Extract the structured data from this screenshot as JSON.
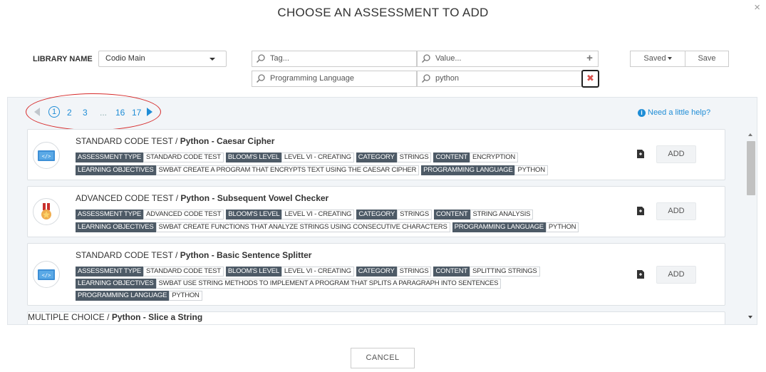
{
  "dialog": {
    "title": "CHOOSE AN ASSESSMENT TO ADD",
    "close_glyph": "×"
  },
  "library": {
    "label": "LIBRARY NAME",
    "selected": "Codio Main"
  },
  "filters": {
    "tag_placeholder": "Tag...",
    "value_placeholder": "Value...",
    "add_glyph": "+",
    "active": [
      {
        "tag": "Programming Language",
        "value": "python",
        "remove_glyph": "✖"
      }
    ]
  },
  "saved": {
    "saved_label": "Saved",
    "save_label": "Save"
  },
  "pagination": {
    "current": "1",
    "pages": [
      "2",
      "3",
      "...",
      "16",
      "17"
    ]
  },
  "help": {
    "label": "Need a little help?",
    "icon": "info-icon"
  },
  "assessments": [
    {
      "type_label": "STANDARD CODE TEST",
      "name": "Python - Caesar Cipher",
      "icon": "code-icon",
      "add_label": "ADD",
      "tags": [
        [
          [
            "ASSESSMENT TYPE",
            "STANDARD CODE TEST"
          ],
          [
            "BLOOM'S LEVEL",
            "LEVEL VI - CREATING"
          ],
          [
            "CATEGORY",
            "STRINGS"
          ],
          [
            "CONTENT",
            "ENCRYPTION"
          ]
        ],
        [
          [
            "LEARNING OBJECTIVES",
            "SWBAT CREATE A PROGRAM THAT ENCRYPTS TEXT USING THE CAESAR CIPHER"
          ],
          [
            "PROGRAMMING LANGUAGE",
            "PYTHON"
          ]
        ]
      ]
    },
    {
      "type_label": "ADVANCED CODE TEST",
      "name": "Python - Subsequent Vowel Checker",
      "icon": "medal-icon",
      "add_label": "ADD",
      "tags": [
        [
          [
            "ASSESSMENT TYPE",
            "ADVANCED CODE TEST"
          ],
          [
            "BLOOM'S LEVEL",
            "LEVEL VI - CREATING"
          ],
          [
            "CATEGORY",
            "STRINGS"
          ],
          [
            "CONTENT",
            "STRING ANALYSIS"
          ]
        ],
        [
          [
            "LEARNING OBJECTIVES",
            "SWBAT CREATE FUNCTIONS THAT ANALYZE STRINGS USING CONSECUTIVE CHARACTERS"
          ],
          [
            "PROGRAMMING LANGUAGE",
            "PYTHON"
          ]
        ]
      ]
    },
    {
      "type_label": "STANDARD CODE TEST",
      "name": "Python - Basic Sentence Splitter",
      "icon": "code-icon",
      "add_label": "ADD",
      "tags": [
        [
          [
            "ASSESSMENT TYPE",
            "STANDARD CODE TEST"
          ],
          [
            "BLOOM'S LEVEL",
            "LEVEL VI - CREATING"
          ],
          [
            "CATEGORY",
            "STRINGS"
          ],
          [
            "CONTENT",
            "SPLITTING STRINGS"
          ]
        ],
        [
          [
            "LEARNING OBJECTIVES",
            "SWBAT USE STRING METHODS TO IMPLEMENT A PROGRAM THAT SPLITS A PARAGRAPH INTO SENTENCES"
          ]
        ],
        [
          [
            "PROGRAMMING LANGUAGE",
            "PYTHON"
          ]
        ]
      ]
    },
    {
      "type_label": "MULTIPLE CHOICE",
      "name": "Python - Slice a String",
      "icon": "",
      "add_label": "",
      "tags": []
    }
  ],
  "footer": {
    "cancel_label": "CANCEL"
  }
}
